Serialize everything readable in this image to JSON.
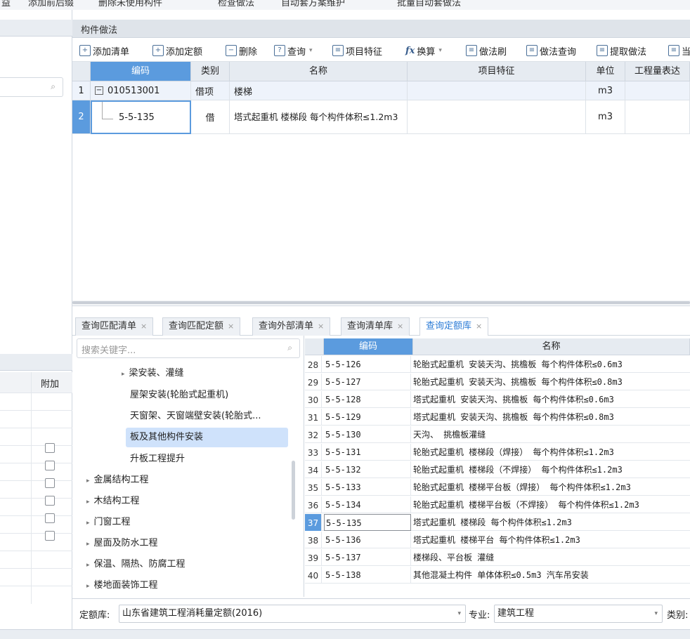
{
  "top_toolbar": {
    "items": [
      "益",
      "添加前后缀",
      "删除未使用构件",
      "检查做法",
      "自动套方案维护",
      "批量自动套做法"
    ]
  },
  "panel": {
    "title": "构件做法"
  },
  "toolbar": {
    "add_list": "添加清单",
    "add_quota": "添加定额",
    "delete": "删除",
    "query": "查询",
    "item_feature": "项目特征",
    "convert": "换算",
    "method_brush": "做法刷",
    "method_query": "做法查询",
    "extract_method": "提取做法",
    "more": "当"
  },
  "grid": {
    "headers": [
      "编码",
      "类别",
      "名称",
      "项目特征",
      "单位",
      "工程量表达"
    ],
    "rows": [
      {
        "num": "1",
        "code": "010513001",
        "type": "借项",
        "name": "楼梯",
        "feature": "",
        "unit": "m3",
        "expand": "−"
      },
      {
        "num": "2",
        "code": "5-5-135",
        "type": "借",
        "name": "塔式起重机 楼梯段 每个构件体积≤1.2m3",
        "feature": "",
        "unit": "m3"
      }
    ]
  },
  "left_panel": {
    "col_attach": "附加"
  },
  "tabs": [
    {
      "label": "查询匹配清单",
      "close": "×"
    },
    {
      "label": "查询匹配定额",
      "close": "×"
    },
    {
      "label": "查询外部清单",
      "close": "×"
    },
    {
      "label": "查询清单库",
      "close": "×"
    },
    {
      "label": "查询定额库",
      "close": "×"
    }
  ],
  "tree": {
    "search_placeholder": "搜索关键字...",
    "items": [
      {
        "label": "梁安装、灌缝",
        "arrow": "▸"
      },
      {
        "label": "屋架安装(轮胎式起重机)"
      },
      {
        "label": "天窗架、天窗端壁安装(轮胎式..."
      },
      {
        "label": "板及其他构件安装",
        "selected": true
      },
      {
        "label": "升板工程提升"
      },
      {
        "label": "金属结构工程",
        "arrow": "▸"
      },
      {
        "label": "木结构工程",
        "arrow": "▸"
      },
      {
        "label": "门窗工程",
        "arrow": "▸"
      },
      {
        "label": "屋面及防水工程",
        "arrow": "▸"
      },
      {
        "label": "保温、隔热、防腐工程",
        "arrow": "▸"
      },
      {
        "label": "楼地面装饰工程",
        "arrow": "▸"
      }
    ]
  },
  "list": {
    "headers": [
      "编码",
      "名称"
    ],
    "rows": [
      {
        "num": "28",
        "code": "5-5-126",
        "name": "轮胎式起重机 安装天沟、挑檐板 每个构件体积≤0.6m3"
      },
      {
        "num": "29",
        "code": "5-5-127",
        "name": "轮胎式起重机 安装天沟、挑檐板 每个构件体积≤0.8m3"
      },
      {
        "num": "30",
        "code": "5-5-128",
        "name": "塔式起重机 安装天沟、挑檐板 每个构件体积≤0.6m3"
      },
      {
        "num": "31",
        "code": "5-5-129",
        "name": "塔式起重机 安装天沟、挑檐板 每个构件体积≤0.8m3"
      },
      {
        "num": "32",
        "code": "5-5-130",
        "name": "天沟、 挑檐板灌缝"
      },
      {
        "num": "33",
        "code": "5-5-131",
        "name": "轮胎式起重机 楼梯段（焊接） 每个构件体积≤1.2m3"
      },
      {
        "num": "34",
        "code": "5-5-132",
        "name": "轮胎式起重机 楼梯段（不焊接） 每个构件体积≤1.2m3"
      },
      {
        "num": "35",
        "code": "5-5-133",
        "name": "轮胎式起重机 楼梯平台板（焊接） 每个构件体积≤1.2m3"
      },
      {
        "num": "36",
        "code": "5-5-134",
        "name": "轮胎式起重机 楼梯平台板（不焊接） 每个构件体积≤1.2m3"
      },
      {
        "num": "37",
        "code": "5-5-135",
        "name": "塔式起重机 楼梯段 每个构件体积≤1.2m3",
        "current": true
      },
      {
        "num": "38",
        "code": "5-5-136",
        "name": "塔式起重机 楼梯平台 每个构件体积≤1.2m3"
      },
      {
        "num": "39",
        "code": "5-5-137",
        "name": "楼梯段、平台板 灌缝"
      },
      {
        "num": "40",
        "code": "5-5-138",
        "name": "其他混凝土构件 单体体积≤0.5m3 汽车吊安装"
      }
    ]
  },
  "bottom": {
    "quota_label": "定额库:",
    "quota_value": "山东省建筑工程消耗量定额(2016)",
    "major_label": "专业:",
    "major_value": "建筑工程",
    "type_label": "类别:"
  },
  "colors": {
    "accent": "#2b7bd6",
    "header_selected": "#5b9bde",
    "tree_selected": "#cfe2fb"
  }
}
